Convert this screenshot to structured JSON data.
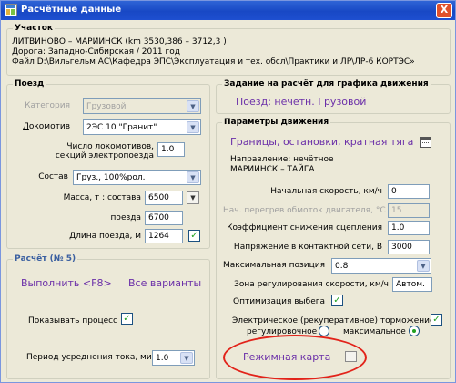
{
  "window": {
    "title": "Расчётные данные",
    "close_label": "X"
  },
  "section": {
    "legend": "Участок",
    "line1": "ЛИТВИНОВО – МАРИИНСК (km 3530,386 – 3712,3 )",
    "line2": "Дорога: Западно-Сибирская  / 2011 год",
    "line3": "Файл D:\\Вильгельм АС\\Кафедра ЭПС\\Эксплуатация и тех. обсл\\Практики и ЛР\\ЛР-6 КОРТЭС»"
  },
  "train": {
    "legend": "Поезд",
    "category_label": "Категория",
    "category_value": "Грузовой",
    "loco_label": "Локомотив",
    "loco_value": "2ЭС 10 \"Гранит\"",
    "loco_count_label_1": "Число  локомотивов,",
    "loco_count_label_2": "секций  электропоезда",
    "loco_count_value": "1.0",
    "consist_label": "Состав",
    "consist_value": "Груз., 100%рол.",
    "mass_label": "Масса, т : состава",
    "mass_value": "6500",
    "mass_train_label": "поезда",
    "mass_train_value": "6700",
    "length_label": "Длина поезда, м",
    "length_value": "1264",
    "length_checked": true
  },
  "calc": {
    "legend": "Расчёт  (№ 5)",
    "run_label": "Выполнить  <F8>",
    "all_variants_label": "Все варианты",
    "show_process_label": "Показывать процесс",
    "show_process_checked": true,
    "period_label": "Период  усреднения тока, мин",
    "period_value": "1.0"
  },
  "schedule": {
    "legend": "Задание на расчёт для графика движения",
    "value": "Поезд: нечётн. Грузовой"
  },
  "motion": {
    "legend": "Параметры движения",
    "boundaries_link": "Границы, остановки, кратная тяга",
    "direction_label": "Направление: нечётное",
    "direction_value": "МАРИИНСК  –  ТАЙГА",
    "start_speed_label": "Начальная  скорость, км/ч",
    "start_speed_value": "0",
    "overheat_label": "Нач. перегрев обмоток двигателя, °С",
    "overheat_value": "15",
    "adhesion_label": "Коэффициент  снижения сцепления",
    "adhesion_value": "1.0",
    "voltage_label": "Напряжение в контактной сети, В",
    "voltage_value": "3000",
    "max_position_label": "Максимальная позиция",
    "max_position_value": "0.8",
    "speed_zone_label": "Зона регулирования скорости, км/ч",
    "speed_zone_value": "Автом.",
    "optimize_label": "Оптимизация выбега",
    "optimize_checked": true,
    "braking_label": "Электрическое (рекуперативное) торможение:",
    "braking_checked": true,
    "reg_label": "регулировочное",
    "max_label": "максимальное",
    "mode_link": "Режимная карта"
  }
}
